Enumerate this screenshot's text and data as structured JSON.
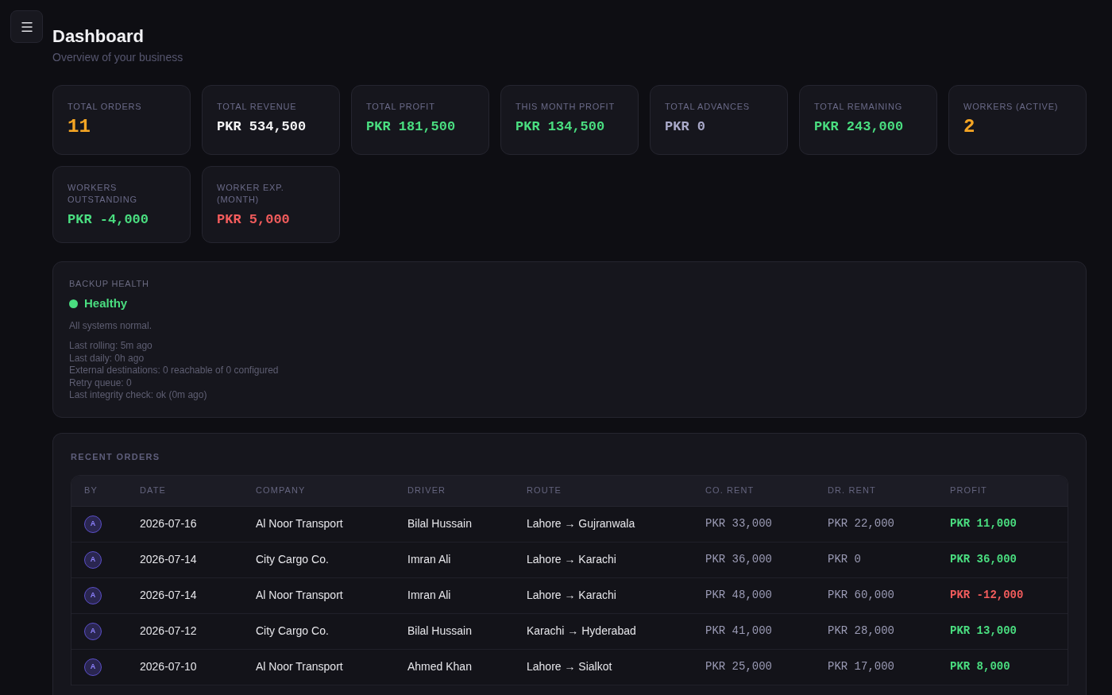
{
  "header": {
    "title": "Dashboard",
    "subtitle": "Overview of your business"
  },
  "stats": [
    {
      "label": "TOTAL ORDERS",
      "value": "11",
      "kind": "count",
      "color": "#f5a524"
    },
    {
      "label": "TOTAL REVENUE",
      "value": "PKR 534,500",
      "kind": "money",
      "color": "#f4f4f5"
    },
    {
      "label": "TOTAL PROFIT",
      "value": "PKR 181,500",
      "kind": "money",
      "color": "#4ade80"
    },
    {
      "label": "THIS MONTH PROFIT",
      "value": "PKR 134,500",
      "kind": "money",
      "color": "#4ade80"
    },
    {
      "label": "TOTAL ADVANCES",
      "value": "PKR 0",
      "kind": "money",
      "color": "#a9a9c9"
    },
    {
      "label": "TOTAL REMAINING",
      "value": "PKR 243,000",
      "kind": "money",
      "color": "#4ade80"
    },
    {
      "label": "WORKERS (ACTIVE)",
      "value": "2",
      "kind": "count",
      "color": "#f5a524"
    },
    {
      "label": "WORKERS OUTSTANDING",
      "value": "PKR -4,000",
      "kind": "money",
      "color": "#4ade80"
    },
    {
      "label": "WORKER EXP. (MONTH)",
      "value": "PKR 5,000",
      "kind": "money",
      "color": "#f25c5c"
    }
  ],
  "backup": {
    "label": "BACKUP HEALTH",
    "status": {
      "text": "Healthy",
      "color": "#4ade80"
    },
    "message": "All systems normal.",
    "details": [
      "Last rolling: 5m ago",
      "Last daily: 0h ago",
      "External destinations: 0 reachable of 0 configured",
      "Retry queue: 0",
      "Last integrity check: ok (0m ago)"
    ]
  },
  "recent_orders": {
    "title": "RECENT ORDERS",
    "columns": [
      "BY",
      "DATE",
      "COMPANY",
      "DRIVER",
      "ROUTE",
      "CO. RENT",
      "DR. RENT",
      "PROFIT"
    ],
    "rows": [
      {
        "by": "A",
        "date": "2026-07-16",
        "company": "Al Noor Transport",
        "driver": "Bilal Hussain",
        "route": "Lahore → Gujranwala",
        "co_rent": "PKR 33,000",
        "dr_rent": "PKR 22,000",
        "profit": "PKR 11,000",
        "color": "#4ade80"
      },
      {
        "by": "A",
        "date": "2026-07-14",
        "company": "City Cargo Co.",
        "driver": "Imran Ali",
        "route": "Lahore → Karachi",
        "co_rent": "PKR 36,000",
        "dr_rent": "PKR 0",
        "profit": "PKR 36,000",
        "color": "#4ade80"
      },
      {
        "by": "A",
        "date": "2026-07-14",
        "company": "Al Noor Transport",
        "driver": "Imran Ali",
        "route": "Lahore → Karachi",
        "co_rent": "PKR 48,000",
        "dr_rent": "PKR 60,000",
        "profit": "PKR -12,000",
        "color": "#f25c5c"
      },
      {
        "by": "A",
        "date": "2026-07-12",
        "company": "City Cargo Co.",
        "driver": "Bilal Hussain",
        "route": "Karachi → Hyderabad",
        "co_rent": "PKR 41,000",
        "dr_rent": "PKR 28,000",
        "profit": "PKR 13,000",
        "color": "#4ade80"
      },
      {
        "by": "A",
        "date": "2026-07-10",
        "company": "Al Noor Transport",
        "driver": "Ahmed Khan",
        "route": "Lahore → Sialkot",
        "co_rent": "PKR 25,000",
        "dr_rent": "PKR 17,000",
        "profit": "PKR 8,000",
        "color": "#4ade80"
      }
    ]
  }
}
